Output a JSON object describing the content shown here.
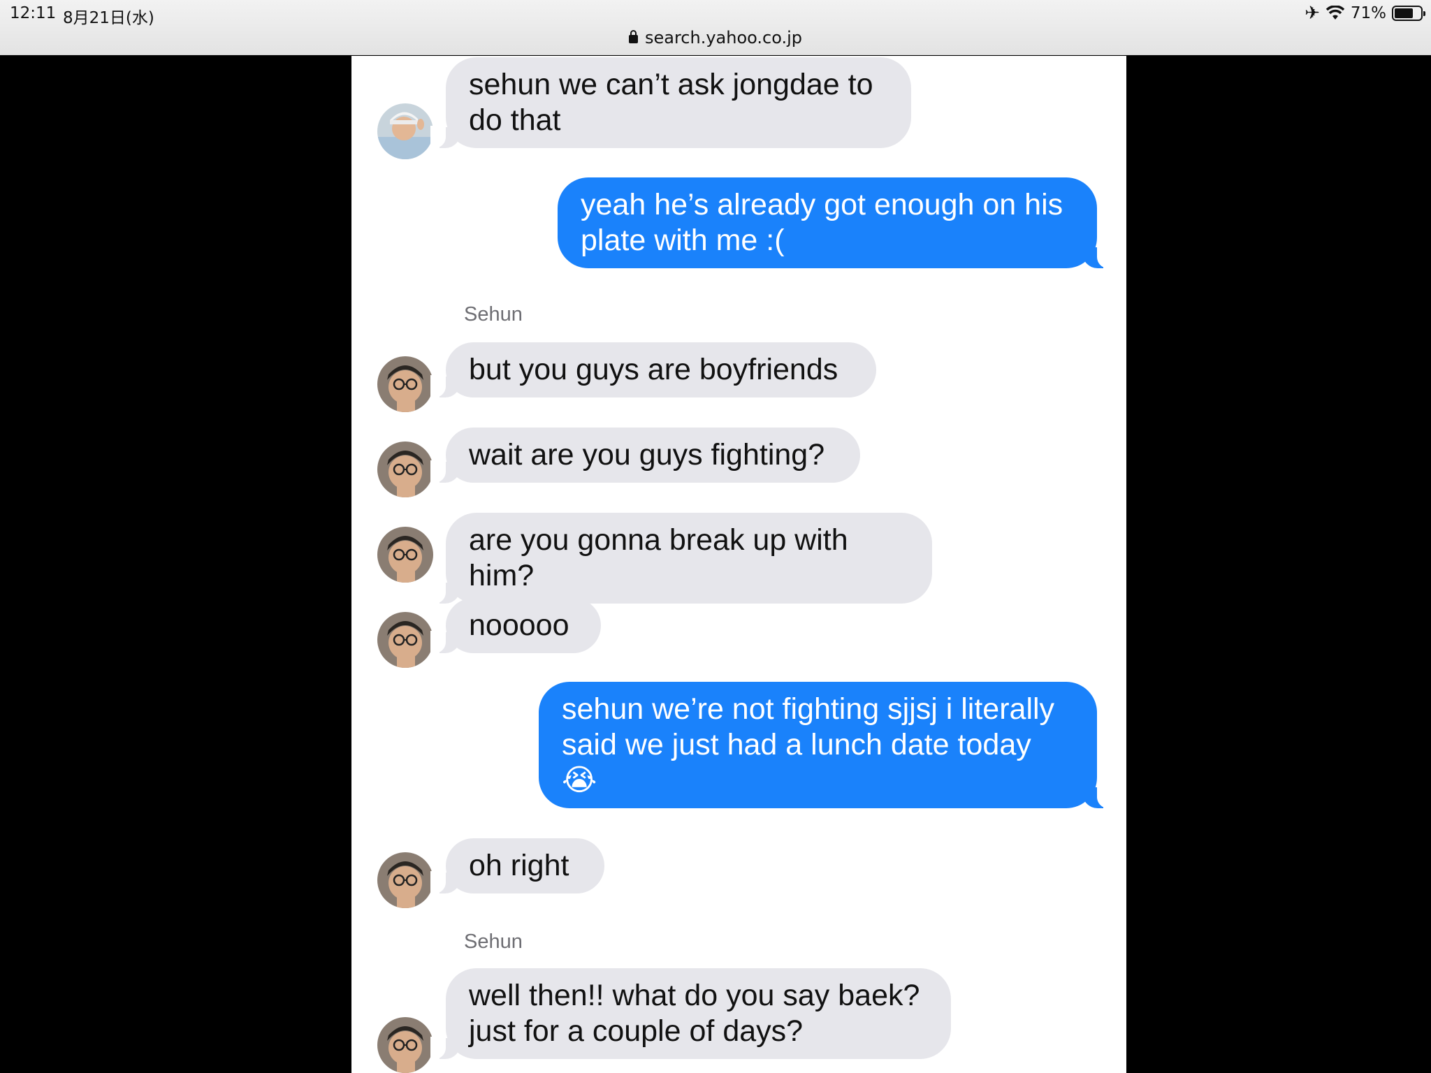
{
  "status_bar": {
    "time": "12:11",
    "date": "8月21日(水)",
    "url": "search.yahoo.co.jp",
    "battery": "71%",
    "battery_level": 0.71,
    "icons": [
      "airplane-icon",
      "wifi-icon",
      "battery-icon",
      "lock-icon"
    ]
  },
  "chat": {
    "colors": {
      "incoming": "#e6e6eb",
      "outgoing": "#1a82fb"
    },
    "messages": [
      {
        "dir": "in",
        "avatar": "avatar-jongdae",
        "text": "sehun we can’t ask jongdae to\ndo that"
      },
      {
        "dir": "out",
        "text": "yeah he’s already got enough on his\nplate with me :("
      },
      {
        "dir": "label",
        "text": "Sehun"
      },
      {
        "dir": "in",
        "avatar": "avatar-sehun",
        "text": "but you guys are boyfriends"
      },
      {
        "dir": "in",
        "avatar": "avatar-sehun",
        "text": "wait are you guys fighting?"
      },
      {
        "dir": "in",
        "avatar": "avatar-sehun",
        "text": "are you gonna break up with him?"
      },
      {
        "dir": "in",
        "avatar": "avatar-sehun",
        "text": "nooooo"
      },
      {
        "dir": "out",
        "text": "sehun we’re not fighting sjjsj i literally\nsaid we just had a lunch date today\n😭"
      },
      {
        "dir": "in",
        "avatar": "avatar-sehun",
        "text": "oh right"
      },
      {
        "dir": "label",
        "text": "Sehun"
      },
      {
        "dir": "in",
        "avatar": "avatar-sehun",
        "text": "well then!! what do you say baek?\njust for a couple of days?"
      }
    ]
  }
}
